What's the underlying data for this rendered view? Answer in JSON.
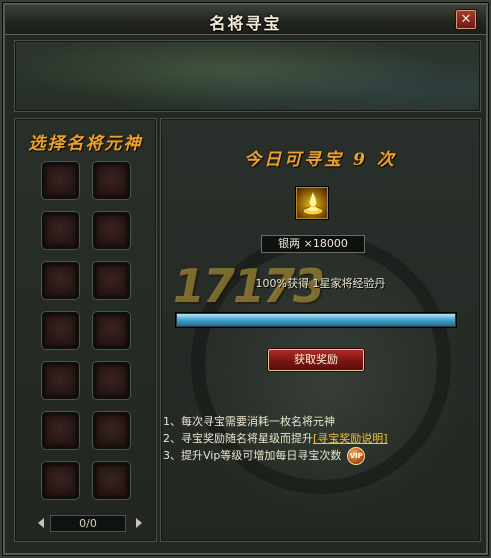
{
  "window": {
    "title": "名将寻宝"
  },
  "icons": {
    "close": "close-icon",
    "treasure": "gold-ingot-icon",
    "vip": "vip-icon"
  },
  "left_panel": {
    "title": "选择名将元神",
    "pager": {
      "value": "0/0"
    }
  },
  "right_panel": {
    "today_count": "今日可寻宝 9 次",
    "cost": "银两 ×18000",
    "reward": "100%获得 1星家将经验丹",
    "progress": 1.0,
    "claim_label": "获取奖励",
    "rules": [
      {
        "num": "1、",
        "text": "每次寻宝需要消耗一枚名将元神"
      },
      {
        "num": "2、",
        "text": "寻宝奖励随名将星级而提升",
        "link": "[寻宝奖励说明]"
      },
      {
        "num": "3、",
        "text": "提升Vip等级可增加每日寻宝次数",
        "badge": "VIP"
      }
    ],
    "watermark": "17173"
  },
  "colors": {
    "title_gold": "#e6a22e",
    "progress_blue": "#4aa7cf",
    "button_red": "#7a1512",
    "link_gold": "#f2c23c"
  }
}
